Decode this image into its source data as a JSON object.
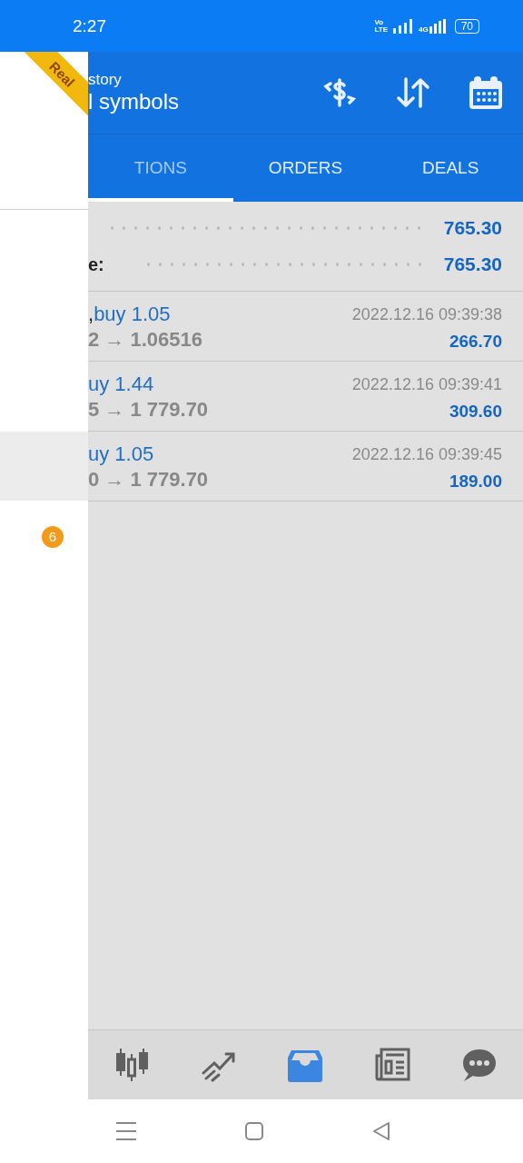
{
  "status_bar": {
    "time": "2:27",
    "volte_top": "Vo",
    "volte_bottom": "LTE",
    "network": "4G",
    "battery": "70"
  },
  "drawer": {
    "ribbon": "Real",
    "badge": "6"
  },
  "header": {
    "subtitle": "story",
    "title": "l symbols"
  },
  "tabs": [
    {
      "label": "TIONS",
      "selected": true
    },
    {
      "label": "ORDERS",
      "selected": false
    },
    {
      "label": "DEALS",
      "selected": false
    }
  ],
  "summary": [
    {
      "value": "765.30"
    },
    {
      "label": "e:",
      "value": "765.30"
    }
  ],
  "deals": [
    {
      "symbol": ",",
      "type": "buy 1.05",
      "prices": "2 → 1.06516",
      "time": "2022.12.16 09:39:38",
      "profit": "266.70"
    },
    {
      "type": "uy 1.44",
      "prices": "5 → 1 779.70",
      "time": "2022.12.16 09:39:41",
      "profit": "309.60"
    },
    {
      "type": "uy 1.05",
      "prices": "0 → 1 779.70",
      "time": "2022.12.16 09:39:45",
      "profit": "189.00"
    }
  ],
  "bottom_nav": [
    {
      "selected": false
    },
    {
      "selected": false
    },
    {
      "selected": true
    },
    {
      "selected": false
    },
    {
      "selected": false
    }
  ]
}
